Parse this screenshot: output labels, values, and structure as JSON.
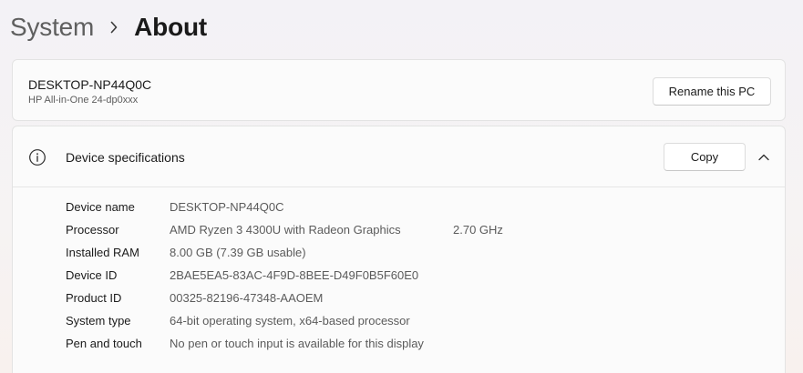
{
  "breadcrumb": {
    "parent": "System",
    "current": "About"
  },
  "pc": {
    "name": "DESKTOP-NP44Q0C",
    "model": "HP All-in-One 24-dp0xxx",
    "rename_label": "Rename this PC"
  },
  "device_specifications": {
    "title": "Device specifications",
    "copy_label": "Copy",
    "expanded": true,
    "rows": [
      {
        "label": "Device name",
        "value": "DESKTOP-NP44Q0C",
        "extra": ""
      },
      {
        "label": "Processor",
        "value": "AMD Ryzen 3 4300U with Radeon Graphics",
        "extra": "2.70 GHz"
      },
      {
        "label": "Installed RAM",
        "value": "8.00 GB (7.39 GB usable)",
        "extra": ""
      },
      {
        "label": "Device ID",
        "value": "2BAE5EA5-83AC-4F9D-8BEE-D49F0B5F60E0",
        "extra": ""
      },
      {
        "label": "Product ID",
        "value": "00325-82196-47348-AAOEM",
        "extra": ""
      },
      {
        "label": "System type",
        "value": "64-bit operating system, x64-based processor",
        "extra": ""
      },
      {
        "label": "Pen and touch",
        "value": "No pen or touch input is available for this display",
        "extra": ""
      }
    ]
  },
  "icons": {
    "breadcrumb_separator": "chevron-right-icon",
    "specs": "info-icon",
    "collapse": "chevron-up-icon"
  },
  "colors": {
    "background": "#f3f2f6",
    "card": "#fbfbfb",
    "card_border": "#e3e3e3",
    "text_primary": "#1b1b1b",
    "text_secondary": "#5b5b5b"
  }
}
